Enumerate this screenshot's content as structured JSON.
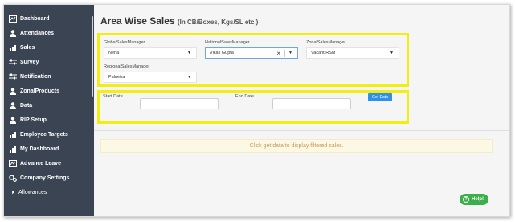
{
  "sidebar": {
    "items": [
      {
        "label": "Dashboard",
        "icon": "dashboard-icon"
      },
      {
        "label": "Attendances",
        "icon": "user-icon"
      },
      {
        "label": "Sales",
        "icon": "chart-icon"
      },
      {
        "label": "Survey",
        "icon": "sliders-icon"
      },
      {
        "label": "Notification",
        "icon": "sliders-icon"
      },
      {
        "label": "ZonalProducts",
        "icon": "user-icon"
      },
      {
        "label": "Data",
        "icon": "user-icon"
      },
      {
        "label": "RIP Setup",
        "icon": "user-icon"
      },
      {
        "label": "Employee Targets",
        "icon": "chart-icon"
      },
      {
        "label": "My Dashboard",
        "icon": "chart-icon"
      },
      {
        "label": "Advance Leave",
        "icon": "dashboard-icon"
      },
      {
        "label": "Company Settings",
        "icon": "gears-icon"
      },
      {
        "label": "Allowances",
        "icon": "caret-right-icon"
      }
    ]
  },
  "page": {
    "title": "Area Wise Sales",
    "subtitle": "(In CB/Boxes, Kgs/SL etc.)"
  },
  "filters": {
    "global_label": "GlobalSalesManager",
    "global_value": "Neha",
    "national_label": "NationalSalesManager",
    "national_value": "Vikas Gupta",
    "zonal_label": "ZonalSalesManager",
    "zonal_value": "Vacant RSM",
    "regional_label": "RegionalSalesManager",
    "regional_value": "Palnetra"
  },
  "dates": {
    "start_label": "Start Date",
    "start_value": "",
    "end_label": "End Date",
    "end_value": "",
    "get_data_label": "Get Data"
  },
  "info": {
    "message": "Click get data to display filtered sales."
  },
  "help": {
    "label": "Help!"
  },
  "colors": {
    "sidebar_bg": "#3a4452",
    "highlight": "#f2ee12",
    "primary_button": "#2e90e8",
    "help_button": "#3cae4a",
    "info_bg": "#fcf8e3"
  }
}
